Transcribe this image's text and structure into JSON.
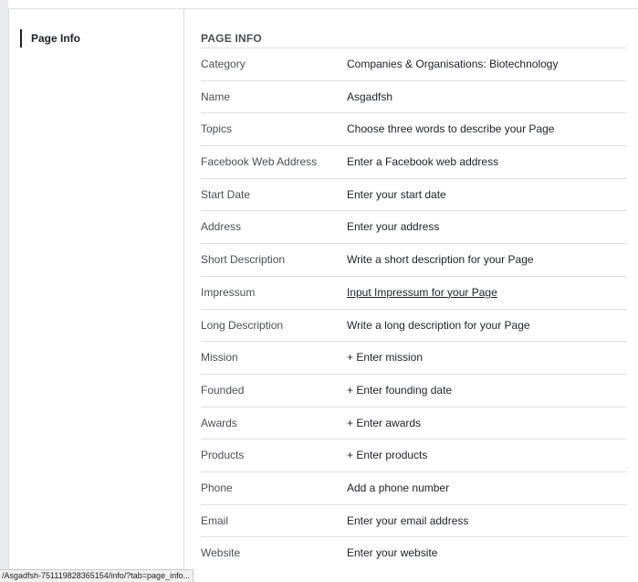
{
  "sidebar": {
    "items": [
      {
        "label": "Page Info"
      }
    ]
  },
  "main": {
    "section_title": "PAGE INFO",
    "rows": [
      {
        "label": "Category",
        "value": "Companies & Organisations: Biotechnology"
      },
      {
        "label": "Name",
        "value": "Asgadfsh"
      },
      {
        "label": "Topics",
        "value": "Choose three words to describe your Page"
      },
      {
        "label": "Facebook Web Address",
        "value": "Enter a Facebook web address"
      },
      {
        "label": "Start Date",
        "value": "Enter your start date"
      },
      {
        "label": "Address",
        "value": "Enter your address"
      },
      {
        "label": "Short Description",
        "value": "Write a short description for your Page"
      },
      {
        "label": "Impressum",
        "value": "Input Impressum for your Page"
      },
      {
        "label": "Long Description",
        "value": "Write a long description for your Page"
      },
      {
        "label": "Mission",
        "value": "+ Enter mission"
      },
      {
        "label": "Founded",
        "value": "+ Enter founding date"
      },
      {
        "label": "Awards",
        "value": "+ Enter awards"
      },
      {
        "label": "Products",
        "value": "+ Enter products"
      },
      {
        "label": "Phone",
        "value": "Add a phone number"
      },
      {
        "label": "Email",
        "value": "Enter your email address"
      },
      {
        "label": "Website",
        "value": "Enter your website"
      }
    ]
  },
  "status_bar": {
    "url": "/Asgadfsh-751119828365154/info/?tab=page_info..."
  }
}
